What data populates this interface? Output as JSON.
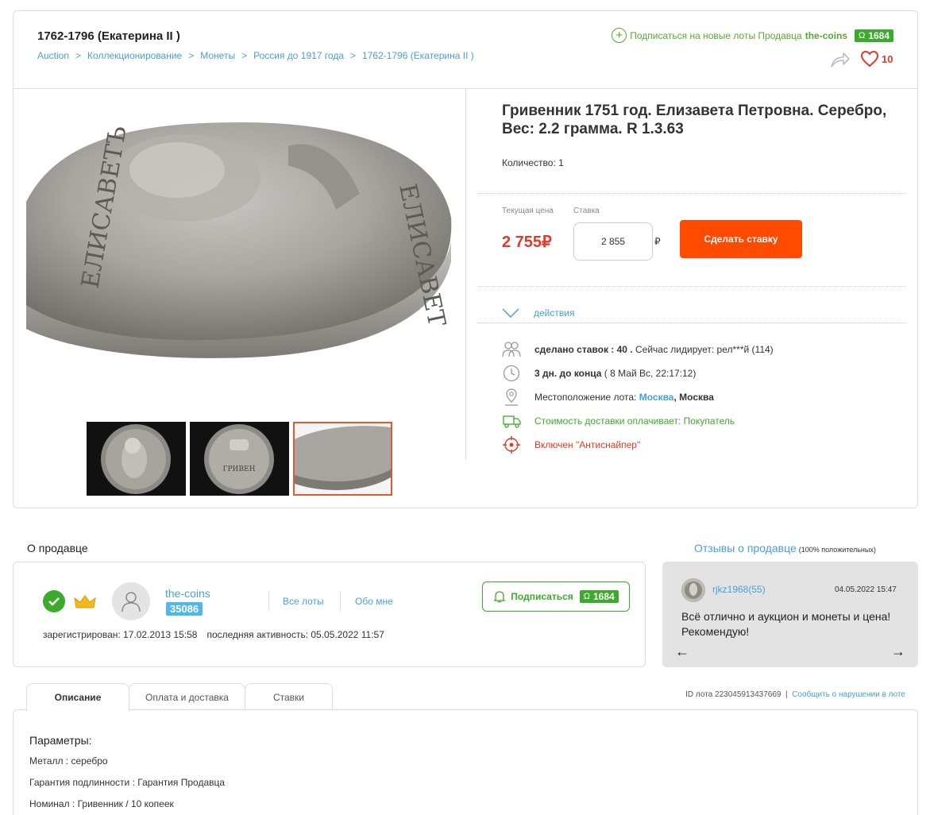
{
  "header": {
    "category_title": "1762-1796 (Екатерина II )",
    "breadcrumb": [
      "Auction",
      "Коллекционирование",
      "Монеты",
      "Россия до 1917 года",
      "1762-1796 (Екатерина II )"
    ],
    "breadcrumb_separator": ">",
    "subscribe_text": "Подписаться на новые лоты Продавца",
    "seller_login": "the-coins",
    "seller_rating": "1684",
    "rating_symbol": "Ω",
    "favorites_count": "10"
  },
  "lot": {
    "title": "Гривенник 1751 год. Елизавета Петровна. Серебро, Вес: 2.2 грамма. R 1.3.63",
    "quantity": "Количество: 1",
    "current_price_label": "Текущая цена",
    "current_price": "2 755₽",
    "bid_label": "Ставка",
    "bid_value": "2 855",
    "currency": "₽",
    "bid_button": "Сделать ставку",
    "actions_label": "действия",
    "bids_text": "сделано ставок : 40 .",
    "leader_text": "Сейчас лидирует: рел***й (114)",
    "time_left": "3 дн. до конца",
    "end_date": "( 8 Май Вс, 22:17:12)",
    "location_label": "Местоположение лота:",
    "location_city": "Москва",
    "location_region": ", Москва",
    "shipping_text": "Стоимость доставки оплачивает: Покупатель",
    "antisniper_text": "Включен \"Антиснайпер\""
  },
  "seller": {
    "section_title": "О продавце",
    "name": "the-coins",
    "rating_badge": "35086",
    "all_lots": "Все лоты",
    "about_me": "Обо мне",
    "subscribe_button": "Подписаться",
    "subscribe_rating": "1684",
    "registered": "зарегистрирован: 17.02.2013 15:58",
    "last_activity": "последняя активность: 05.05.2022 11:57"
  },
  "reviews": {
    "title": "Отзывы о продавце",
    "positive": "(100% положительных)",
    "user": "rjkz1968(55)",
    "date": "04.05.2022 15:47",
    "text": "Всё отлично и аукцион и монеты и цена! Рекомендую!",
    "prev_arrow": "←",
    "next_arrow": "→"
  },
  "tabs": [
    "Описание",
    "Оплата и доставка",
    "Ставки"
  ],
  "lot_meta": {
    "lot_id": "ID лота 223045913437669",
    "separator": "|",
    "report": "Сообщить о нарушении в лоте"
  },
  "params": {
    "title": "Параметры:",
    "items": [
      "Металл : серебро",
      "Гарантия подлинности : Гарантия Продавца",
      "Номинал : Гривенник / 10 копеек"
    ]
  },
  "colors": {
    "accent_blue": "#4a9fd8",
    "bid_orange": "#ff4a00",
    "price_red": "#e03a2a",
    "green": "#3caa2c"
  }
}
